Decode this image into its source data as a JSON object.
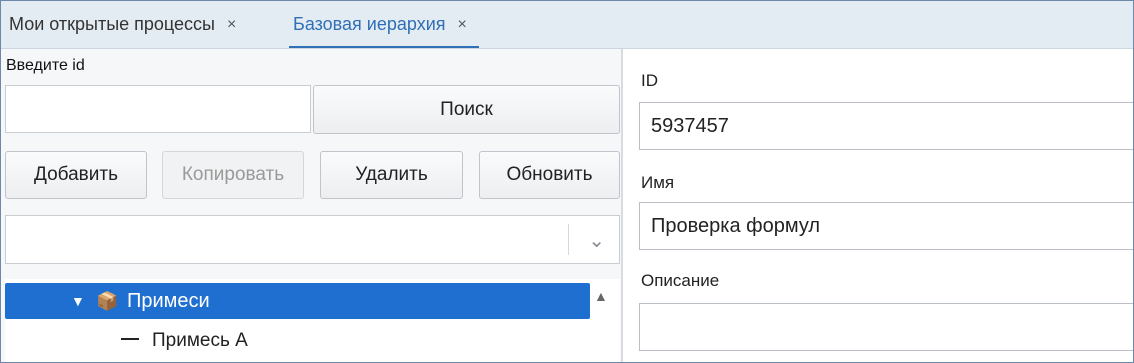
{
  "tabs": [
    {
      "label": "Мои открытые процессы",
      "close": "×"
    },
    {
      "label": "Базовая иерархия",
      "close": "×"
    }
  ],
  "left": {
    "id_label": "Введите id",
    "id_value": "",
    "search_label": "Поиск",
    "buttons": {
      "add": "Добавить",
      "copy": "Копировать",
      "delete": "Удалить",
      "refresh": "Обновить"
    },
    "combo_value": "",
    "tree": [
      {
        "label": "Примеси",
        "expanded": true,
        "selected": true,
        "icon": "box-icon"
      },
      {
        "label": "Примесь A",
        "expanded": false,
        "selected": false,
        "icon": "leaf-dash-icon"
      }
    ]
  },
  "right": {
    "id_label": "ID",
    "id_value": "5937457",
    "name_label": "Имя",
    "name_value": "Проверка формул",
    "desc_label": "Описание",
    "desc_value": ""
  },
  "colors": {
    "accent": "#2f6fb6",
    "selection": "#1e6fd0",
    "tabbar": "#e4ecf3"
  }
}
